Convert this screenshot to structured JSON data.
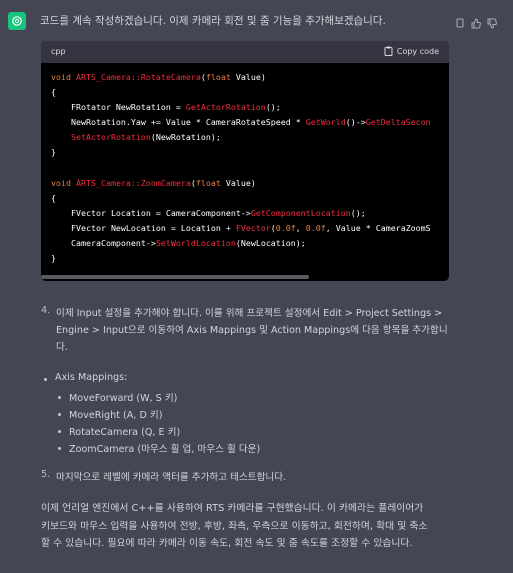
{
  "message": {
    "intro": "코드를 계속 작성하겠습니다. 이제 카메라 회전 및 줌 기능을 추가해보겠습니다.",
    "icons": [
      "copy-icon",
      "thumbs-up-icon",
      "thumbs-down-icon"
    ]
  },
  "code_block": {
    "language": "cpp",
    "copy_label": "Copy code",
    "lines": [
      [
        [
          "kw",
          "void "
        ],
        [
          "fn",
          "ARTS_Camera::RotateCamera"
        ],
        [
          "p",
          "("
        ],
        [
          "kw",
          "float"
        ],
        [
          "p",
          " Value)"
        ]
      ],
      [
        [
          "p",
          "{"
        ]
      ],
      [
        [
          "p",
          "    FRotator NewRotation = "
        ],
        [
          "fn",
          "GetActorRotation"
        ],
        [
          "p",
          "();"
        ]
      ],
      [
        [
          "p",
          "    NewRotation.Yaw += Value * CameraRotateSpeed * "
        ],
        [
          "fn",
          "GetWorld"
        ],
        [
          "p",
          "()->"
        ],
        [
          "fn",
          "GetDeltaSecon"
        ]
      ],
      [
        [
          "p",
          "    "
        ],
        [
          "fn",
          "SetActorRotation"
        ],
        [
          "p",
          "(NewRotation);"
        ]
      ],
      [
        [
          "p",
          "}"
        ]
      ],
      [
        [
          "p",
          ""
        ]
      ],
      [
        [
          "kw",
          "void "
        ],
        [
          "fn",
          "ARTS_Camera::ZoomCamera"
        ],
        [
          "p",
          "("
        ],
        [
          "kw",
          "float"
        ],
        [
          "p",
          " Value)"
        ]
      ],
      [
        [
          "p",
          "{"
        ]
      ],
      [
        [
          "p",
          "    FVector Location = CameraComponent->"
        ],
        [
          "fn",
          "GetComponentLocation"
        ],
        [
          "p",
          "();"
        ]
      ],
      [
        [
          "p",
          "    FVector NewLocation = Location + "
        ],
        [
          "fn",
          "FVector"
        ],
        [
          "p",
          "("
        ],
        [
          "num",
          "0.0f"
        ],
        [
          "p",
          ", "
        ],
        [
          "num",
          "0.0f"
        ],
        [
          "p",
          ", Value * CameraZoomS"
        ]
      ],
      [
        [
          "p",
          "    CameraComponent->"
        ],
        [
          "fn",
          "SetWorldLocation"
        ],
        [
          "p",
          "(NewLocation);"
        ]
      ],
      [
        [
          "p",
          "}"
        ]
      ]
    ]
  },
  "steps": [
    {
      "num": "4.",
      "lines": [
        "이제 Input 설정을 추가해야 합니다. 이를 위해 프로젝트 설정에서 Edit > Project Settings >",
        "Engine > Input으로 이동하여 Axis Mappings 및 Action Mappings에 다음 항목을 추가합니",
        "다."
      ]
    },
    {
      "num": "5.",
      "lines": [
        "마지막으로 레벨에 카메라 액터를 추가하고 테스트합니다."
      ]
    }
  ],
  "axis_mappings": {
    "title": "Axis Mappings:",
    "items": [
      "MoveForward (W, S 키)",
      "MoveRight (A, D 키)",
      "RotateCamera (Q, E 키)",
      "ZoomCamera (마우스 휠 업, 마우스 휠 다운)"
    ]
  },
  "summary": {
    "lines": [
      "이제 언리얼 엔진에서 C++를 사용하여 RTS 카메라를 구현했습니다. 이 카메라는 플레이어가",
      "키보드와 마우스 입력을 사용하여 전방, 후방, 좌측, 우측으로 이동하고, 회전하며, 확대 및 축소",
      "할 수 있습니다. 필요에 따라 카메라 이동 속도, 회전 속도 및 줌 속도를 조정할 수 있습니다."
    ]
  }
}
